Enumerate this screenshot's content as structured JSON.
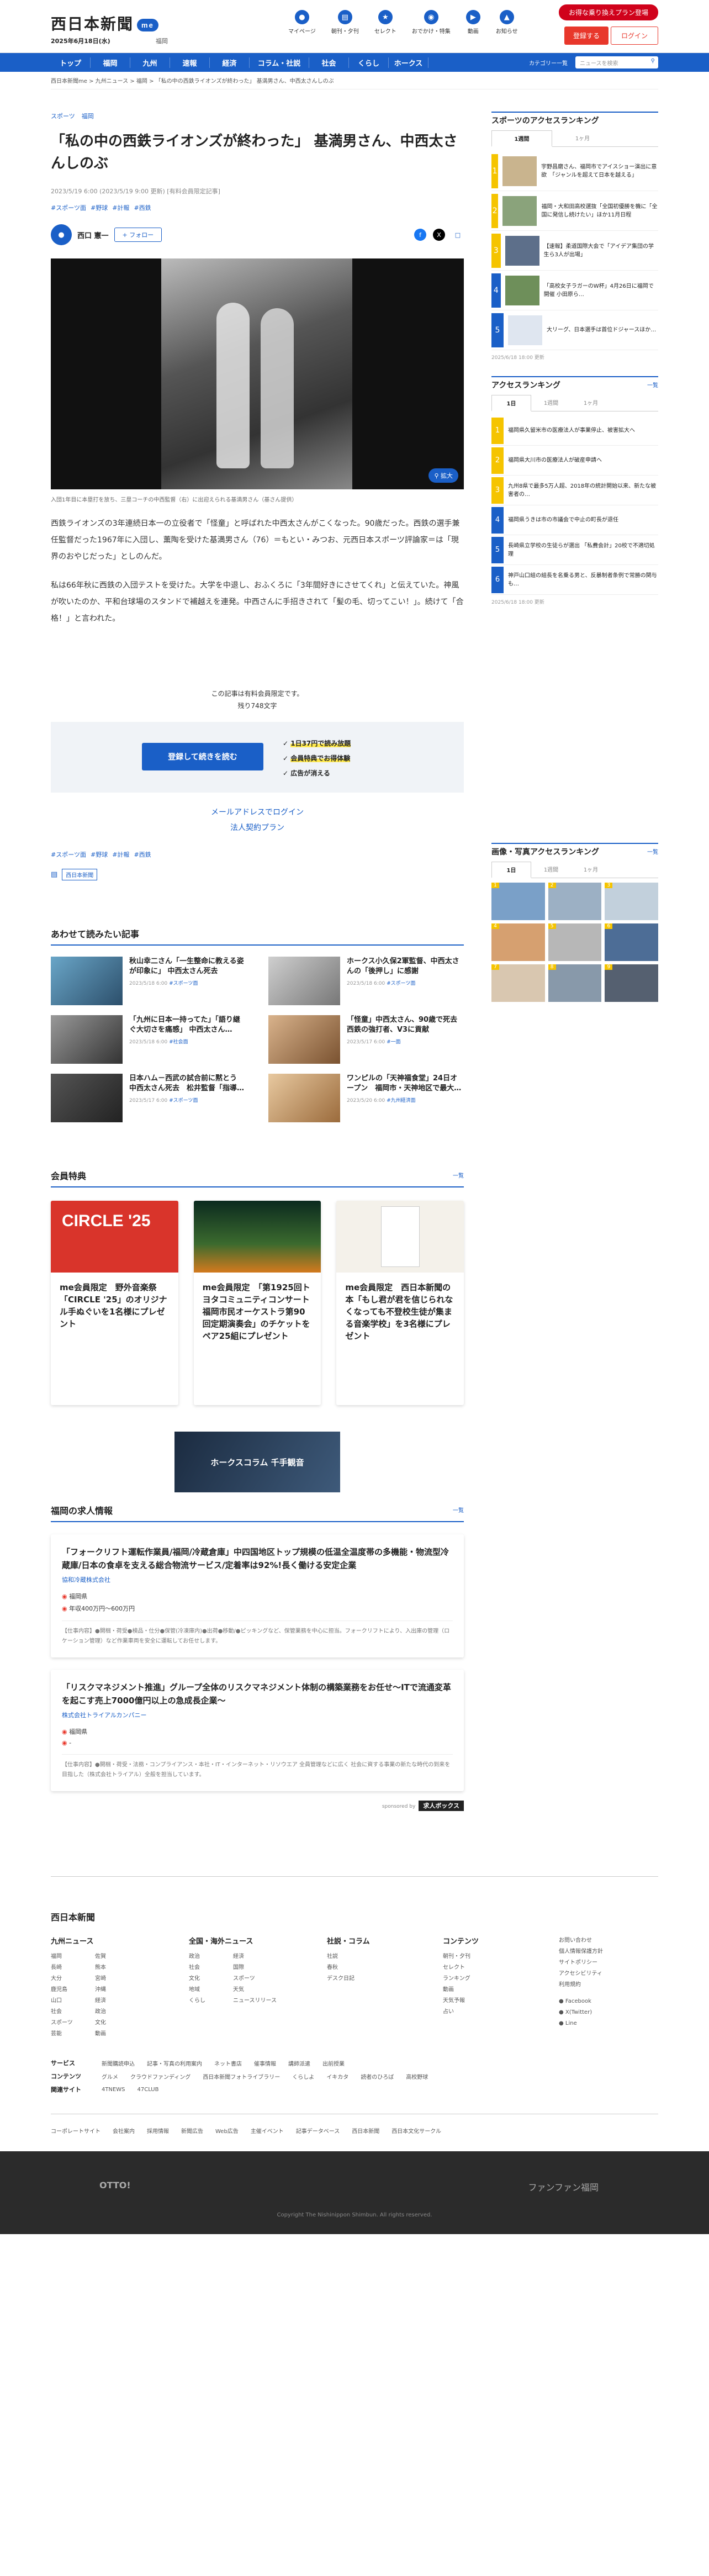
{
  "header": {
    "logo": "西日本新聞",
    "logo_badge": "me",
    "date": "2025年6月18日(水)",
    "weather": "福岡",
    "icons": [
      {
        "label": "マイページ",
        "icon": "user-icon"
      },
      {
        "label": "朝刊・夕刊",
        "icon": "newspaper-icon"
      },
      {
        "label": "セレクト",
        "icon": "select-icon"
      },
      {
        "label": "おでかけ・特集",
        "icon": "pin-icon"
      },
      {
        "label": "動画",
        "icon": "video-icon"
      },
      {
        "label": "お知らせ",
        "icon": "bell-icon"
      }
    ],
    "promo": "お得な乗り換えプラン登場",
    "register": "登録する",
    "login": "ログイン"
  },
  "nav": {
    "items": [
      "トップ",
      "福岡",
      "九州",
      "速報",
      "経済",
      "コラム・社説",
      "社会",
      "くらし",
      "ホークス"
    ],
    "category": "カテゴリー一覧",
    "search_placeholder": "ニュースを検索"
  },
  "breadcrumb": [
    "西日本新聞me",
    "九州ニュース",
    "福岡",
    "「私の中の西鉄ライオンズが終わった」 基満男さん、中西太さんしのぶ"
  ],
  "article": {
    "tags": [
      "スポーツ",
      "福岡"
    ],
    "title": "「私の中の西鉄ライオンズが終わった」 基満男さん、中西太さんしのぶ",
    "meta": "2023/5/19 6:00 (2023/5/19 9:00 更新) [有料会員限定記事]",
    "keywords": [
      "#スポーツ面",
      "#野球",
      "#計報",
      "#西鉄"
    ],
    "author": "西口 憲一",
    "follow": "+ フォロー",
    "share": [
      "f",
      "X",
      "□"
    ],
    "zoom": "拡大",
    "caption": "入団1年目に本塁打を放ち、三塁コーチの中西監督（右）に出迎えられる基満男さん（基さん提供）",
    "paragraphs": [
      "西鉄ライオンズの3年連続日本一の立役者で「怪童」と呼ばれた中西太さんがこくなった。90歳だった。西鉄の選手兼任監督だった1967年に入団し、薫陶を受けた基満男さん（76）＝もとい・みつお、元西日本スポーツ評論家＝は「現界のおやじだった」としのんだ。",
      "私は66年秋に西鉄の入団テストを受けた。大学を中退し、おふくろに「3年間好きにさせてくれ」と伝えていた。神風が吹いたのか、平和台球場のスタンドで補越えを連発。中西さんに手招きされて「髪の毛、切ってこい！」。続けて「合格！」と言われた。"
    ],
    "paid_notice": "この記事は有料会員限定です。",
    "remaining": "残り748文字",
    "register_cta": "登録して続きを読む",
    "benefits": [
      "1日37円で読み放題",
      "会員特典でお得体験",
      "広告が消える"
    ],
    "email_login": "メールアドレスでログイン",
    "plan": "法人契約プラン",
    "keywords2": [
      "#スポーツ面",
      "#野球",
      "#計報",
      "#西鉄"
    ],
    "publisher": "西日本新聞"
  },
  "related": {
    "title": "あわせて読みたい記事",
    "items": [
      {
        "text": "秋山幸二さん「一生整命に教える姿が印象に」 中西太さん死去",
        "date": "2023/5/18 6:00",
        "tag": "#スポーツ面"
      },
      {
        "text": "ホークス小久保2軍監督、中西太さんの「後押し」に感謝",
        "date": "2023/5/18 6:00",
        "tag": "#スポーツ面"
      },
      {
        "text": "「九州に日本一持ってた」「語り継ぐ大切さを痛感」 中西太さん…",
        "date": "2023/5/18 6:00",
        "tag": "#社会面"
      },
      {
        "text": "「怪童」中西太さん、90歳で死去　西鉄の強打者、V3に貢献",
        "date": "2023/5/17 6:00",
        "tag": "#一面"
      },
      {
        "text": "日本ハム－西武の試合前に黙とう　中西太さん死去　松井監督「指導…",
        "date": "2023/5/17 6:00",
        "tag": "#スポーツ面"
      },
      {
        "text": "ワンピルの「天神福食堂」24日オープン　福岡市・天神地区で最大…",
        "date": "2023/5/20 6:00",
        "tag": "#九州経済面"
      }
    ]
  },
  "benefits_section": {
    "title": "会員特典",
    "more": "一覧",
    "cards": [
      {
        "text": "me会員限定　野外音楽祭「CIRCLE '25」のオリジナル手ぬぐいを1名様にプレゼント",
        "img_text": "CIRCLE '25"
      },
      {
        "text": "me会員限定　「第1925回トヨタコミュニティコンサート 福岡市民オーケストラ第90回定期演奏会」のチケットをペア25組にプレゼント",
        "img_text": ""
      },
      {
        "text": "me会員限定　西日本新聞の本「もし君が君を信じられなくなっても不登校生徒が集まる音楽学校」を3名様にプレゼント",
        "img_text": ""
      }
    ]
  },
  "ad": {
    "text": "ホークスコラム 千手観音"
  },
  "jobs": {
    "title": "福岡の求人情報",
    "more": "一覧",
    "items": [
      {
        "title": "「フォークリフト運転作業員/福岡/冷蔵倉庫」中四国地区トップ規模の低温全温度帯の多機能・物流型冷蔵庫/日本の食卓を支える総合物流サービス/定着率は92%!長く働ける安定企業",
        "company": "協和冷蔵株式会社",
        "location": "福岡県",
        "salary": "年収400万円〜600万円",
        "desc": "【仕事内容】●開梱・荷受●検品・仕分●保管(冷凍庫内)●出荷●移動/●ピッキングなど、保管業務を中心に担当。フォークリフトにより、入出庫の管理（ロケーション管理）など作業車両を安全に運転してお任せします。"
      },
      {
        "title": "「リスクマネジメント推進」グループ全体のリスクマネジメント体制の構築業務をお任せ〜ITで流通変革を起こす売上7000億円以上の急成長企業〜",
        "company": "株式会社トライアルカンパニー",
        "location": "福岡県",
        "salary": "-",
        "desc": "【仕事内容】●開梱・荷受・法務・コンプライアンス・本社・IT・インターネット・リソウエア 全員管理などに広く 社会に資する事業の新たな時代の到来を目指した（株式会社トライアル）全般を担当しています。"
      }
    ],
    "sponsor": "sponsored by",
    "sponsor_logo": "求人ボックス"
  },
  "sidebar": {
    "sports_rank": {
      "title": "スポーツのアクセスランキング",
      "tabs": [
        "1週間",
        "1ヶ月"
      ],
      "items": [
        "宇野昌磨さん、福岡市でアイスショー演出に意欲　「ジャンルを超えて日本を越える」",
        "福岡・大和田高校選抜「全国初優勝を機に「全国に発信し続けたい」ほか11月日程",
        "【速報】柔道国際大会で「アイデア集団の学生ら3人が出場」",
        "「高校女子ラガーのW杯」4月26日に福岡で開催 小田原ら…",
        "大リーグ、日本選手は首位ドジャースほか…"
      ],
      "updated": "2025/6/18 18:00 更新"
    },
    "access_rank": {
      "title": "アクセスランキング",
      "more": "一覧",
      "tabs": [
        "1日",
        "1週間",
        "1ヶ月"
      ],
      "items": [
        "福岡県久留米市の医療法人が事業停止、被害拡大へ",
        "福岡県大川市の医療法人が破産申請へ",
        "九州8県で最多5万人超、2018年の統計開始以来、新たな被害者の…",
        "福岡県うきは市の市議会で中止の町長が退任",
        "長崎県立学校の生徒らが選出 「私費会計」20校で不適切処理",
        "神戸山口組の組長を名乗る男と、反暴制者条例で常勝の関与も…"
      ],
      "updated": "2025/6/18 18:00 更新"
    },
    "photo_rank": {
      "title": "画像・写真アクセスランキング",
      "more": "一覧",
      "tabs": [
        "1日",
        "1週間",
        "1ヶ月"
      ],
      "count": 9
    }
  },
  "footer": {
    "logo": "西日本新聞",
    "cols": [
      {
        "title": "九州ニュース",
        "items": [
          "福岡",
          "佐賀",
          "長崎",
          "熊本",
          "大分",
          "宮崎",
          "鹿児島",
          "沖縄",
          "山口",
          "経済",
          "社会",
          "政治",
          "スポーツ",
          "文化",
          "芸能",
          "動画"
        ]
      },
      {
        "title": "全国・海外ニュース",
        "items": [
          "政治",
          "経済",
          "社会",
          "国際",
          "文化",
          "スポーツ",
          "地域",
          "天気",
          "くらし",
          "ニュースリリース"
        ]
      },
      {
        "title": "社説・コラム",
        "items": [
          "社説",
          "春秋",
          "デスク日記"
        ]
      },
      {
        "title": "コンテンツ",
        "items": [
          "朝刊・夕刊",
          "セレクト",
          "ランキング",
          "動画",
          "天気予報",
          "占い"
        ]
      }
    ],
    "right_links": [
      "お問い合わせ",
      "個人情報保護方針",
      "サイトポリシー",
      "アクセシビリティ",
      "利用規約",
      "Facebook",
      "X(Twitter)",
      "Line"
    ],
    "service_label": "サービス",
    "service_items": [
      "新聞購読申込",
      "記事・写真の利用案内",
      "ネット書店",
      "催事情報",
      "講師派遣",
      "出前授業"
    ],
    "content_label": "コンテンツ",
    "content_items": [
      "グルメ",
      "クラウドファンディング",
      "西日本新聞フォトライブラリー",
      "くらしよ",
      "イキカタ",
      "読者のひろば",
      "高校野球"
    ],
    "partner_label": "関連サイト",
    "partner_items": [
      "4TNEWS",
      "47CLUB"
    ],
    "bottom": [
      "コーポレートサイト",
      "会社案内",
      "採用情報",
      "新聞広告",
      "Web広告",
      "主催イベント",
      "記事データベース",
      "西日本新聞",
      "西日本文化サークル"
    ],
    "dark_left": "OTTO!",
    "dark_right": "ファンファン福岡",
    "copyright": "Copyright The Nishinippon Shimbun. All rights reserved."
  }
}
